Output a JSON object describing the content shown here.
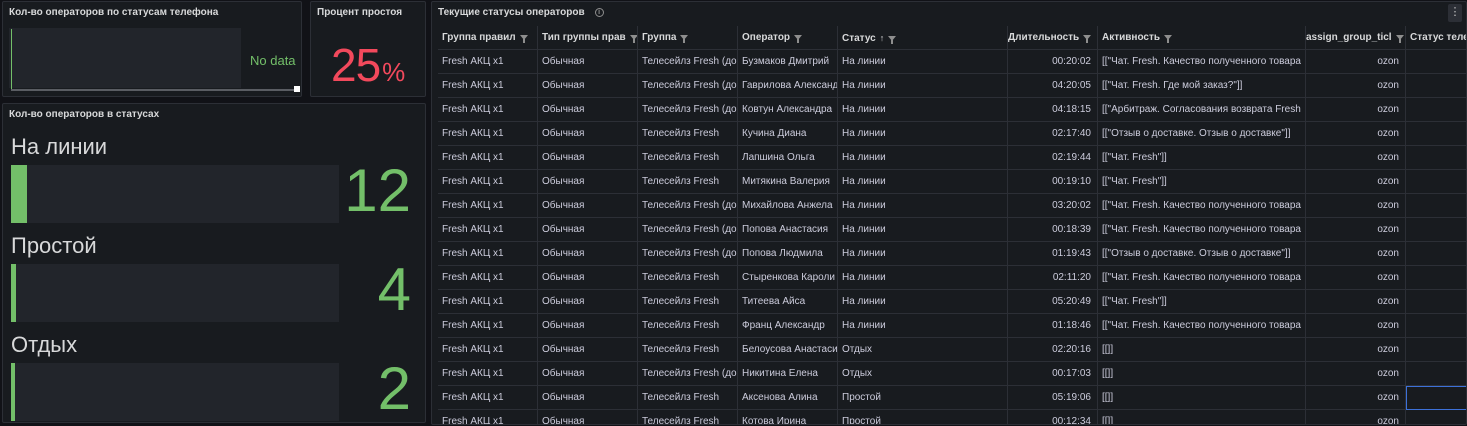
{
  "panels": {
    "phone_status": {
      "title": "Кол-во операторов по статусам телефона",
      "nodata": "No data"
    },
    "idle_percent": {
      "title": "Процент простоя",
      "value": "25",
      "unit": "%"
    },
    "status_counts": {
      "title": "Кол-во операторов в статусах",
      "items": [
        {
          "name": "На линии",
          "value": "12",
          "fill_fraction": 0.05
        },
        {
          "name": "Простой",
          "value": "4",
          "fill_fraction": 0.016
        },
        {
          "name": "Отдых",
          "value": "2",
          "fill_fraction": 0.01
        }
      ],
      "color": "#73bf69"
    },
    "operators": {
      "title": "Текущие статусы операторов",
      "columns": [
        "Группа правил",
        "Тип группы прав",
        "Группа",
        "Оператор",
        "Статус",
        "Длительность",
        "Активность",
        "assign_group_ticl",
        "Статус теле"
      ],
      "rows": [
        [
          "Fresh АКЦ x1",
          "Обычная",
          "Телесейлз Fresh (до",
          "Бузмаков Дмитрий",
          "На линии",
          "00:20:02",
          "[[\"Чат. Fresh. Качество полученного товара",
          "ozon",
          ""
        ],
        [
          "Fresh АКЦ x1",
          "Обычная",
          "Телесейлз Fresh (до",
          "Гаврилова Александ",
          "На линии",
          "04:20:05",
          "[[\"Чат. Fresh. Где мой заказ?\"]]",
          "ozon",
          ""
        ],
        [
          "Fresh АКЦ x1",
          "Обычная",
          "Телесейлз Fresh (до",
          "Ковтун Александра",
          "На линии",
          "04:18:15",
          "[[\"Арбитраж. Согласования возврата Fresh",
          "ozon",
          ""
        ],
        [
          "Fresh АКЦ x1",
          "Обычная",
          "Телесейлз Fresh",
          "Кучина Диана",
          "На линии",
          "02:17:40",
          "[[\"Отзыв о доставке. Отзыв о доставке\"]]",
          "ozon",
          ""
        ],
        [
          "Fresh АКЦ x1",
          "Обычная",
          "Телесейлз Fresh",
          "Лапшина Ольга",
          "На линии",
          "02:19:44",
          "[[\"Чат. Fresh\"]]",
          "ozon",
          ""
        ],
        [
          "Fresh АКЦ x1",
          "Обычная",
          "Телесейлз Fresh",
          "Митякина Валерия",
          "На линии",
          "00:19:10",
          "[[\"Чат. Fresh\"]]",
          "ozon",
          ""
        ],
        [
          "Fresh АКЦ x1",
          "Обычная",
          "Телесейлз Fresh (до",
          "Михайлова Анжела",
          "На линии",
          "03:20:02",
          "[[\"Чат. Fresh. Качество полученного товара",
          "ozon",
          ""
        ],
        [
          "Fresh АКЦ x1",
          "Обычная",
          "Телесейлз Fresh (до",
          "Попова Анастасия",
          "На линии",
          "00:18:39",
          "[[\"Чат. Fresh. Качество полученного товара",
          "ozon",
          ""
        ],
        [
          "Fresh АКЦ x1",
          "Обычная",
          "Телесейлз Fresh (до",
          "Попова Людмила",
          "На линии",
          "01:19:43",
          "[[\"Отзыв о доставке. Отзыв о доставке\"]]",
          "ozon",
          ""
        ],
        [
          "Fresh АКЦ x1",
          "Обычная",
          "Телесейлз Fresh",
          "Стыренкова Кароли",
          "На линии",
          "02:11:20",
          "[[\"Чат. Fresh. Качество полученного товара",
          "ozon",
          ""
        ],
        [
          "Fresh АКЦ x1",
          "Обычная",
          "Телесейлз Fresh",
          "Титеева Айса",
          "На линии",
          "05:20:49",
          "[[\"Чат. Fresh\"]]",
          "ozon",
          ""
        ],
        [
          "Fresh АКЦ x1",
          "Обычная",
          "Телесейлз Fresh",
          "Франц Александр",
          "На линии",
          "01:18:46",
          "[[\"Чат. Fresh. Качество полученного товара",
          "ozon",
          ""
        ],
        [
          "Fresh АКЦ x1",
          "Обычная",
          "Телесейлз Fresh",
          "Белоусова Анастаси",
          "Отдых",
          "02:20:16",
          "[[]]",
          "ozon",
          ""
        ],
        [
          "Fresh АКЦ x1",
          "Обычная",
          "Телесейлз Fresh (до",
          "Никитина Елена",
          "Отдых",
          "00:17:03",
          "[[]]",
          "ozon",
          ""
        ],
        [
          "Fresh АКЦ x1",
          "Обычная",
          "Телесейлз Fresh",
          "Аксенова Алина",
          "Простой",
          "05:19:06",
          "[[]]",
          "ozon",
          ""
        ],
        [
          "Fresh АКЦ x1",
          "Обычная",
          "Телесейлз Fresh",
          "Котова Ирина",
          "Простой",
          "00:12:34",
          "[[]]",
          "ozon",
          ""
        ]
      ]
    }
  },
  "colors": {
    "green": "#73bf69",
    "red": "#f2495c",
    "background": "#111217",
    "panel": "#181b1f"
  }
}
